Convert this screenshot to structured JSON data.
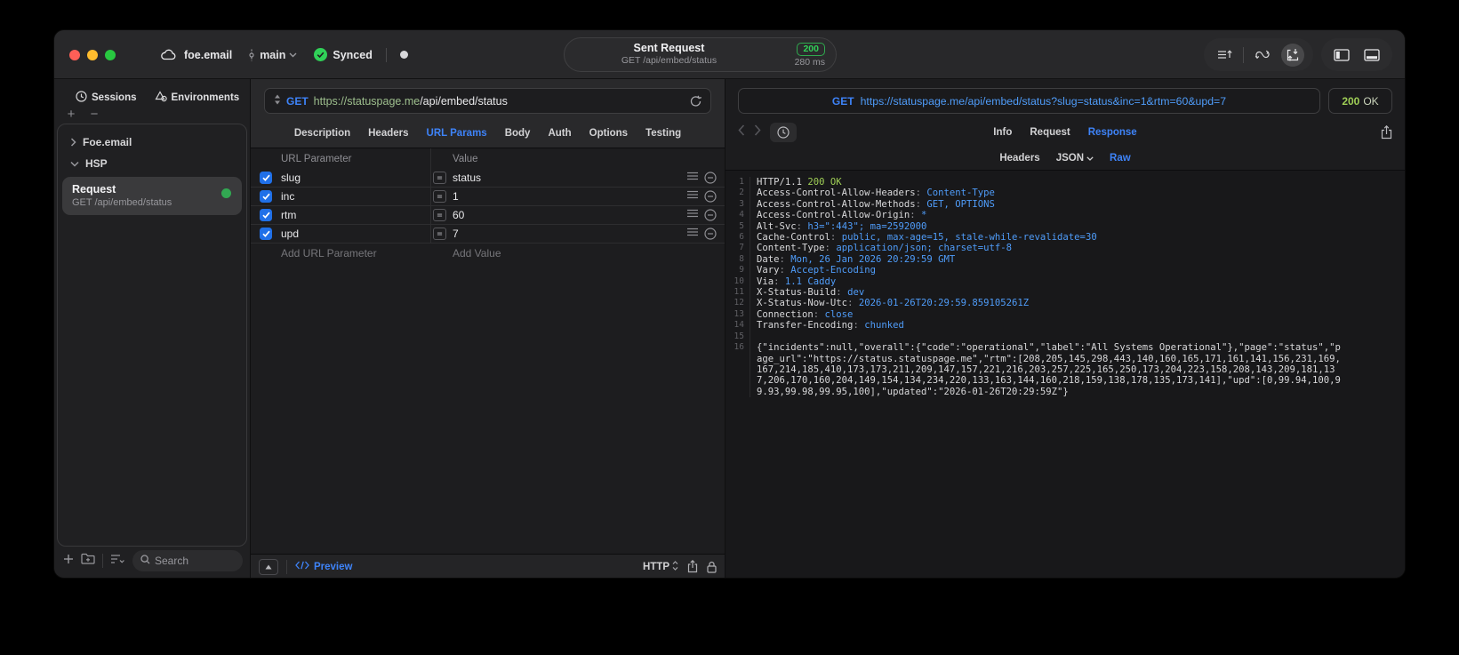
{
  "titlebar": {
    "project": "foe.email",
    "branch": "main",
    "sync": "Synced",
    "center": {
      "title": "Sent Request",
      "method_path": "GET /api/embed/status",
      "status_code": "200",
      "duration": "280 ms"
    }
  },
  "sidebar": {
    "tabs": [
      {
        "label": "Sessions"
      },
      {
        "label": "Environments"
      }
    ],
    "add_label": "+",
    "remove_label": "−",
    "tree": [
      {
        "label": "Foe.email"
      },
      {
        "label": "HSP"
      }
    ],
    "request": {
      "title": "Request",
      "subtitle": "GET /api/embed/status"
    },
    "search_placeholder": "Search"
  },
  "request_panel": {
    "method": "GET",
    "url_host": "https://statuspage.me",
    "url_path": "/api/embed/status",
    "tabs": [
      "Description",
      "Headers",
      "URL Params",
      "Body",
      "Auth",
      "Options",
      "Testing"
    ],
    "active_tab": "URL Params",
    "params": {
      "col_name": "URL Parameter",
      "col_value": "Value",
      "rows": [
        {
          "enabled": true,
          "name": "slug",
          "value": "status"
        },
        {
          "enabled": true,
          "name": "inc",
          "value": "1"
        },
        {
          "enabled": true,
          "name": "rtm",
          "value": "60"
        },
        {
          "enabled": true,
          "name": "upd",
          "value": "7"
        }
      ],
      "add_parameter_label": "Add URL Parameter",
      "add_value_label": "Add Value"
    },
    "footer": {
      "preview_label": "Preview",
      "protocol": "HTTP"
    }
  },
  "response_panel": {
    "method": "GET",
    "url": "https://statuspage.me/api/embed/status?slug=status&inc=1&rtm=60&upd=7",
    "status_code": "200",
    "status_text": "OK",
    "tabs": [
      "Info",
      "Request",
      "Response"
    ],
    "active_tab": "Response",
    "subtabs": [
      "Headers",
      "JSON",
      "Raw"
    ],
    "active_subtab": "Raw",
    "body": {
      "status_line": "HTTP/1.1",
      "status_value": "200 OK",
      "headers": [
        {
          "name": "Access-Control-Allow-Headers",
          "value": "Content-Type"
        },
        {
          "name": "Access-Control-Allow-Methods",
          "value": "GET, OPTIONS"
        },
        {
          "name": "Access-Control-Allow-Origin",
          "value": "*"
        },
        {
          "name": "Alt-Svc",
          "value": "h3=\":443\"; ma=2592000"
        },
        {
          "name": "Cache-Control",
          "value": "public, max-age=15, stale-while-revalidate=30"
        },
        {
          "name": "Content-Type",
          "value": "application/json; charset=utf-8"
        },
        {
          "name": "Date",
          "value": "Mon, 26 Jan 2026 20:29:59 GMT"
        },
        {
          "name": "Vary",
          "value": "Accept-Encoding"
        },
        {
          "name": "Via",
          "value": "1.1 Caddy"
        },
        {
          "name": "X-Status-Build",
          "value": "dev"
        },
        {
          "name": "X-Status-Now-Utc",
          "value": "2026-01-26T20:29:59.859105261Z"
        },
        {
          "name": "Connection",
          "value": "close"
        },
        {
          "name": "Transfer-Encoding",
          "value": "chunked"
        }
      ],
      "json_body": "{\"incidents\":null,\"overall\":{\"code\":\"operational\",\"label\":\"All Systems Operational\"},\"page\":\"status\",\"page_url\":\"https://status.statuspage.me\",\"rtm\":[208,205,145,298,443,140,160,165,171,161,141,156,231,169,167,214,185,410,173,173,211,209,147,157,221,216,203,257,225,165,250,173,204,223,158,208,143,209,181,137,206,170,160,204,149,154,134,234,220,133,163,144,160,218,159,138,178,135,173,141],\"upd\":[0,99.94,100,99.93,99.98,99.95,100],\"updated\":\"2026-01-26T20:29:59Z\"}"
    }
  },
  "colors": {
    "accent_blue": "#3e83f8",
    "link_blue": "#4f9cf9",
    "success_green": "#30d158",
    "status_green": "#9fce56"
  }
}
